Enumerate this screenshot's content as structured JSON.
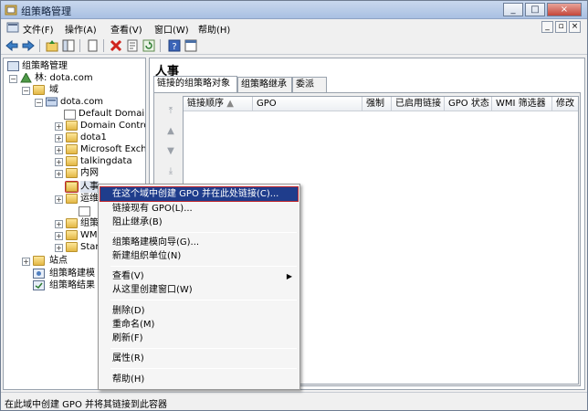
{
  "window": {
    "title": "组策略管理",
    "min_label": "_",
    "max_label": "□",
    "close_label": "×"
  },
  "menubar": {
    "items": [
      "文件(F)",
      "操作(A)",
      "查看(V)",
      "窗口(W)",
      "帮助(H)"
    ],
    "mdi": [
      "_",
      "▫",
      "×"
    ]
  },
  "toolbar": {
    "icons": [
      "back-arrow-icon",
      "forward-arrow-icon",
      "up-folder-icon",
      "show-hide-tree-icon",
      "copy-icon",
      "delete-icon",
      "properties-icon",
      "refresh-icon",
      "help-icon",
      "console-icon"
    ]
  },
  "tree": {
    "root": "组策略管理",
    "forest": "林: dota.com",
    "domains": "域",
    "domain": "dota.com",
    "children": [
      "Default Domain",
      "Domain Control",
      "dota1",
      "Microsoft Exch",
      "talkingdata",
      "内网",
      "人事",
      "运维",
      "组策",
      "WMI",
      "Star"
    ],
    "sites": "站点",
    "modeling": "组策略建模",
    "results": "组策略结果"
  },
  "right": {
    "title": "人事",
    "tabs": [
      "链接的组策略对象",
      "组策略继承",
      "委派"
    ],
    "columns": [
      "链接顺序",
      "GPO",
      "强制",
      "已启用链接",
      "GPO 状态",
      "WMI 筛选器",
      "修改"
    ]
  },
  "context_menu": {
    "groups": [
      [
        "在这个域中创建 GPO 并在此处链接(C)...",
        "链接现有 GPO(L)...",
        "阻止继承(B)"
      ],
      [
        "组策略建模向导(G)...",
        "新建组织单位(N)"
      ],
      [
        "查看(V)",
        "从这里创建窗口(W)"
      ],
      [
        "删除(D)",
        "重命名(M)",
        "刷新(F)"
      ],
      [
        "属性(R)"
      ],
      [
        "帮助(H)"
      ]
    ],
    "highlighted": "在这个域中创建 GPO 并在此处链接(C)...",
    "submenu_item": "查看(V)"
  },
  "status": {
    "text": "在此域中创建 GPO 并将其链接到此容器"
  },
  "colors": {
    "highlight": "#1f3d8c",
    "annotation_red": "#c0282f",
    "titlebar": "#b7cbe8"
  }
}
